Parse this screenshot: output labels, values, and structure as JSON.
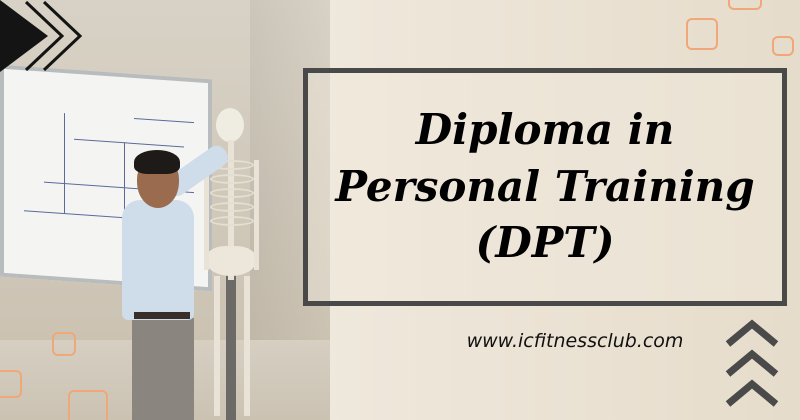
{
  "banner": {
    "title_line1": "Diploma in",
    "title_line2": "Personal Training",
    "title_line3": "(DPT)",
    "website": "www.icfitnessclub.com"
  },
  "icons": {
    "top_left": "play-arrow-icon",
    "bottom_right": "chevrons-up-icon"
  },
  "colors": {
    "accent_orange": "#f0a77a",
    "panel_border": "#494949",
    "background": "#ece4d6"
  }
}
